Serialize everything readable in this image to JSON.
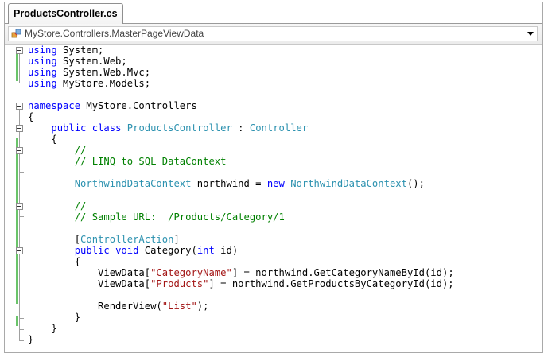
{
  "tab": {
    "title": "ProductsController.cs"
  },
  "navbar": {
    "member": "MyStore.Controllers.MasterPageViewData"
  },
  "colors": {
    "keyword": "#0000ff",
    "type": "#2b91af",
    "comment": "#008000",
    "string": "#a31515",
    "changebar": "#6ac46a"
  },
  "code_lines": [
    [
      [
        "kw",
        "using"
      ],
      [
        "t",
        " System;"
      ]
    ],
    [
      [
        "kw",
        "using"
      ],
      [
        "t",
        " System.Web;"
      ]
    ],
    [
      [
        "kw",
        "using"
      ],
      [
        "t",
        " System.Web.Mvc;"
      ]
    ],
    [
      [
        "kw",
        "using"
      ],
      [
        "t",
        " MyStore.Models;"
      ]
    ],
    [],
    [
      [
        "kw",
        "namespace"
      ],
      [
        "t",
        " MyStore.Controllers"
      ]
    ],
    [
      [
        "t",
        "{"
      ]
    ],
    [
      [
        "t",
        "    "
      ],
      [
        "kw",
        "public"
      ],
      [
        "t",
        " "
      ],
      [
        "kw",
        "class"
      ],
      [
        "t",
        " "
      ],
      [
        "ty",
        "ProductsController"
      ],
      [
        "t",
        " : "
      ],
      [
        "ty",
        "Controller"
      ]
    ],
    [
      [
        "t",
        "    {"
      ]
    ],
    [
      [
        "t",
        "        "
      ],
      [
        "cm",
        "//"
      ]
    ],
    [
      [
        "t",
        "        "
      ],
      [
        "cm",
        "// LINQ to SQL DataContext"
      ]
    ],
    [],
    [
      [
        "t",
        "        "
      ],
      [
        "ty",
        "NorthwindDataContext"
      ],
      [
        "t",
        " northwind = "
      ],
      [
        "kw",
        "new"
      ],
      [
        "t",
        " "
      ],
      [
        "ty",
        "NorthwindDataContext"
      ],
      [
        "t",
        "();"
      ]
    ],
    [],
    [
      [
        "t",
        "        "
      ],
      [
        "cm",
        "//"
      ]
    ],
    [
      [
        "t",
        "        "
      ],
      [
        "cm",
        "// Sample URL:  /Products/Category/1"
      ]
    ],
    [],
    [
      [
        "t",
        "        ["
      ],
      [
        "ty",
        "ControllerAction"
      ],
      [
        "t",
        "]"
      ]
    ],
    [
      [
        "t",
        "        "
      ],
      [
        "kw",
        "public"
      ],
      [
        "t",
        " "
      ],
      [
        "kw",
        "void"
      ],
      [
        "t",
        " Category("
      ],
      [
        "kw",
        "int"
      ],
      [
        "t",
        " id)"
      ]
    ],
    [
      [
        "t",
        "        {"
      ]
    ],
    [
      [
        "t",
        "            ViewData["
      ],
      [
        "st",
        "\"CategoryName\""
      ],
      [
        "t",
        "] = northwind.GetCategoryNameById(id);"
      ]
    ],
    [
      [
        "t",
        "            ViewData["
      ],
      [
        "st",
        "\"Products\""
      ],
      [
        "t",
        "] = northwind.GetProductsByCategoryId(id);"
      ]
    ],
    [],
    [
      [
        "t",
        "            RenderView("
      ],
      [
        "st",
        "\"List\""
      ],
      [
        "t",
        ");"
      ]
    ],
    [
      [
        "t",
        "        }"
      ]
    ],
    [
      [
        "t",
        "    }"
      ]
    ],
    [
      [
        "t",
        "}"
      ]
    ]
  ]
}
